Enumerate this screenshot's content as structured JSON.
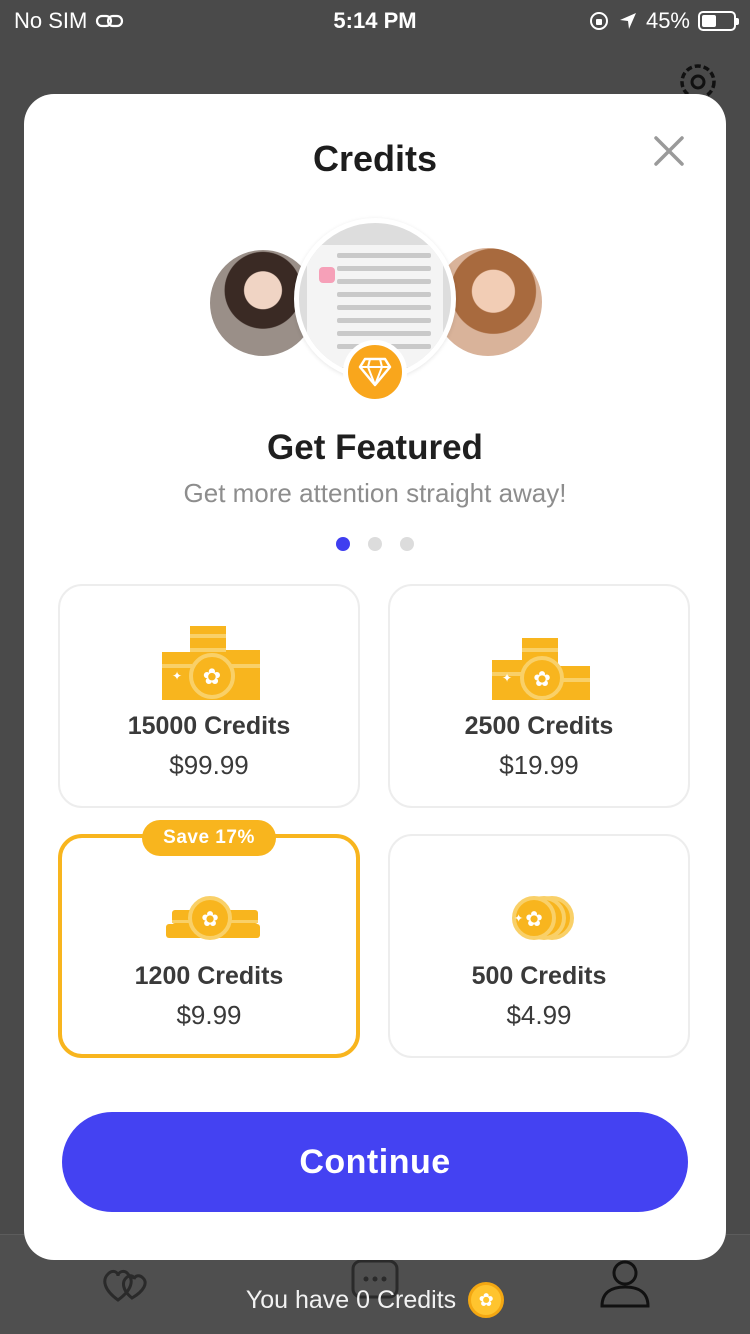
{
  "status_bar": {
    "carrier": "No SIM",
    "time": "5:14 PM",
    "battery": "45%",
    "battery_level": 0.45
  },
  "modal": {
    "title": "Credits",
    "close_icon": "close-icon"
  },
  "feature": {
    "title": "Get Featured",
    "subtitle": "Get more attention straight away!",
    "page_count": 3,
    "active_page": 1
  },
  "packages": [
    {
      "name": "15000 Credits",
      "price": "$99.99",
      "selected": false
    },
    {
      "name": "2500 Credits",
      "price": "$19.99",
      "selected": false
    },
    {
      "name": "1200 Credits",
      "price": "$9.99",
      "selected": true,
      "badge": "Save 17%"
    },
    {
      "name": "500 Credits",
      "price": "$4.99",
      "selected": false
    }
  ],
  "actions": {
    "continue_label": "Continue"
  },
  "footer": {
    "credits_note": "You have 0 Credits"
  },
  "colors": {
    "accent": "#4442F2",
    "gold": "#F8B51E",
    "active_dot": "#3F3EF0"
  }
}
